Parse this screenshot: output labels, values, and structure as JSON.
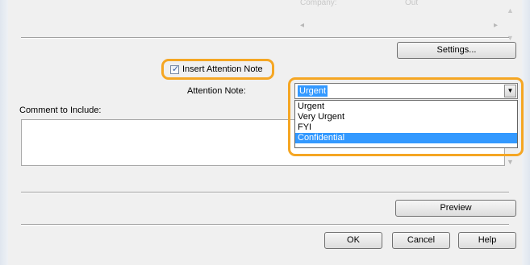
{
  "faded_header": {
    "col1": "Company:",
    "col2": "Out"
  },
  "buttons": {
    "settings": "Settings...",
    "preview": "Preview",
    "ok": "OK",
    "cancel": "Cancel",
    "help": "Help"
  },
  "attention": {
    "checkbox_label": "Insert Attention Note",
    "checked": true,
    "note_label": "Attention Note:",
    "selected_value": "Urgent",
    "options": [
      "Urgent",
      "Very Urgent",
      "FYI",
      "Confidential"
    ],
    "highlighted_option": "Confidential"
  },
  "comment": {
    "label": "Comment to Include:",
    "value": ""
  },
  "colors": {
    "highlight": "#f5a623",
    "selection": "#3399ff"
  }
}
